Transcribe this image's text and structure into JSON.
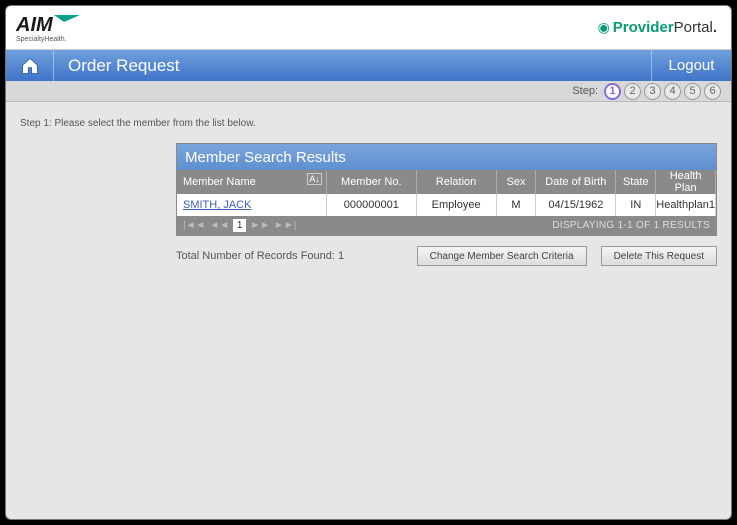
{
  "brand": {
    "aim_main": "AIM",
    "aim_sub": "SpecialtyHealth.",
    "provider_strong": "Provider",
    "provider_portal": "Portal",
    "provider_dot": "."
  },
  "nav": {
    "title": "Order Request",
    "logout": "Logout"
  },
  "steps": {
    "label": "Step:",
    "items": [
      "1",
      "2",
      "3",
      "4",
      "5",
      "6"
    ],
    "active_index": 0
  },
  "instruction": "Step 1: Please select the member from the list below.",
  "panel": {
    "title": "Member Search Results",
    "columns": {
      "member_name": "Member Name",
      "member_no": "Member No.",
      "relation": "Relation",
      "sex": "Sex",
      "dob": "Date of Birth",
      "state": "State",
      "health_plan": "Health Plan"
    },
    "rows": [
      {
        "member_name": "SMITH, JACK",
        "member_no": "000000001",
        "relation": "Employee",
        "sex": "M",
        "dob": "04/15/1962",
        "state": "IN",
        "health_plan": "Healthplan1"
      }
    ],
    "pager": {
      "current_page": "1",
      "display": "DISPLAYING 1-1 OF 1 RESULTS"
    }
  },
  "below": {
    "total": "Total Number of Records Found: 1",
    "change_btn": "Change Member Search Criteria",
    "delete_btn": "Delete This Request"
  }
}
